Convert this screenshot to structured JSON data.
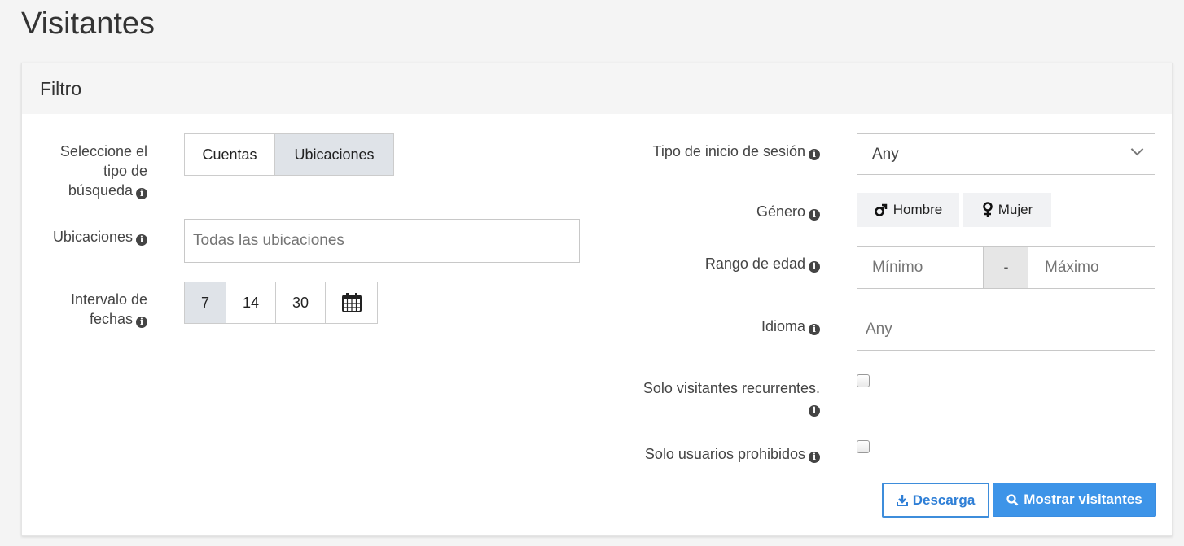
{
  "page": {
    "title": "Visitantes"
  },
  "filter": {
    "title": "Filtro",
    "search_type": {
      "label_lines": [
        "Seleccione el",
        "tipo de",
        "búsqueda"
      ],
      "options": [
        "Cuentas",
        "Ubicaciones"
      ],
      "selected": "Ubicaciones"
    },
    "locations": {
      "label": "Ubicaciones",
      "placeholder": "Todas las ubicaciones"
    },
    "date_range": {
      "label_lines": [
        "Intervalo de",
        "fechas"
      ],
      "options": [
        "7",
        "14",
        "30"
      ],
      "selected": "7",
      "calendar_icon": "calendar-icon"
    },
    "login_type": {
      "label": "Tipo de inicio de sesión",
      "value": "Any"
    },
    "gender": {
      "label": "Género",
      "male": "Hombre",
      "female": "Mujer",
      "male_icon": "mars-icon",
      "female_icon": "venus-icon"
    },
    "age_range": {
      "label": "Rango de edad",
      "min_placeholder": "Mínimo",
      "separator": "-",
      "max_placeholder": "Máximo"
    },
    "language": {
      "label": "Idioma",
      "placeholder": "Any"
    },
    "recurring_only": {
      "label_lines": [
        "Solo visitantes recurrentes."
      ],
      "checked": false
    },
    "banned_only": {
      "label": "Solo usuarios prohibidos",
      "checked": false
    },
    "actions": {
      "download": "Descarga",
      "show": "Mostrar visitantes"
    },
    "colors": {
      "accent": "#3d94e8",
      "active_segment": "#dfe3e8"
    }
  }
}
